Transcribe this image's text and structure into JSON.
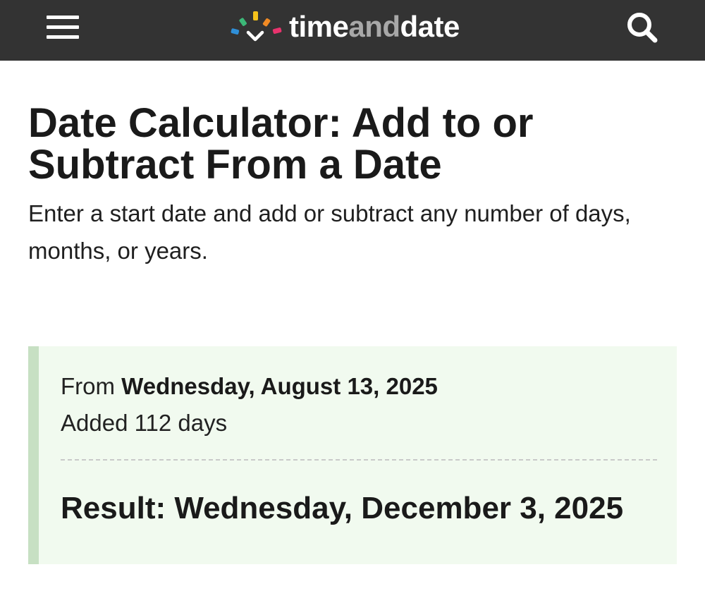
{
  "header": {
    "menu_icon": "hamburger-menu-icon",
    "search_icon": "magnifier-search-icon",
    "logo": {
      "part1": "time",
      "part2": "and",
      "part3": "date",
      "dot_colors": [
        "#2f8fd8",
        "#3cb878",
        "#f5c21b",
        "#f08a24",
        "#e8336d"
      ]
    },
    "background": "#333333"
  },
  "page": {
    "title": "Date Calculator: Add to or Subtract From a Date",
    "intro": "Enter a start date and add or subtract any number of days, months, or years."
  },
  "result": {
    "from_prefix": "From",
    "from_date": "Wednesday, August 13, 2025",
    "added": "Added 112 days",
    "result_text": "Result: Wednesday, December 3, 2025",
    "box_background": "#f1faef",
    "box_border": "#c7e0c3"
  }
}
